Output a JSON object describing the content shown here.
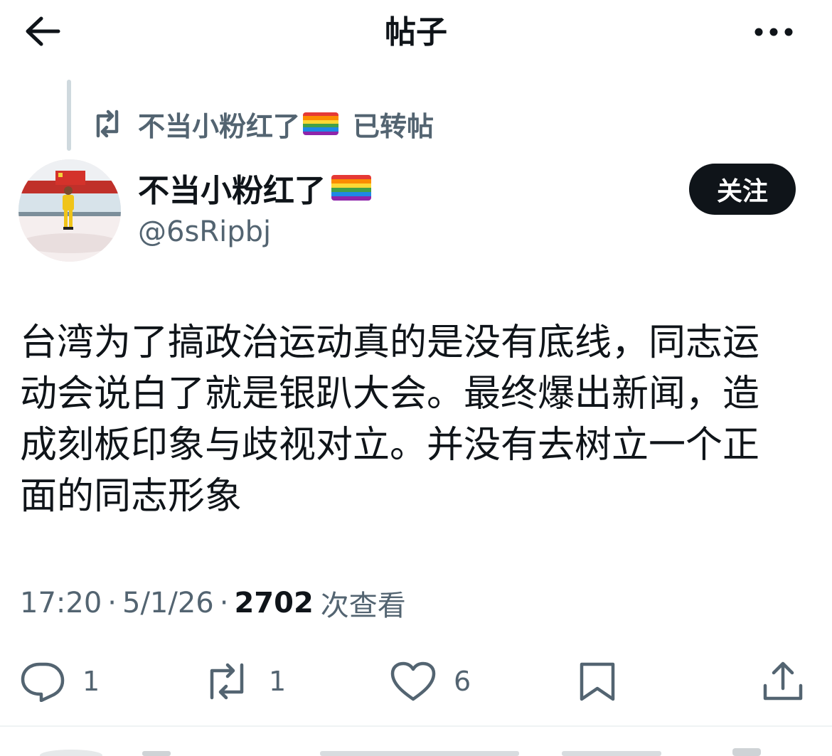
{
  "header": {
    "title": "帖子",
    "back_icon": "arrow-left-icon",
    "more_icon": "more-horizontal-icon"
  },
  "repost_context": {
    "icon": "repost-icon",
    "user": "不当小粉红了",
    "suffix": "已转帖"
  },
  "post": {
    "avatar_icon": "avatar-photo",
    "display_name": "不当小粉红了",
    "name_emoji": "rainbow-flag-icon",
    "handle": "@6sRipbj",
    "follow_label": "关注",
    "text": "台湾为了搞政治运动真的是没有底线，同志运动会说白了就是银趴大会。最终爆出新闻，造成刻板印象与歧视对立。并没有去树立一个正面的同志形象",
    "time": "17:20",
    "date": "5/1/26",
    "separator": "·",
    "views_count": "2702",
    "views_label": "次查看"
  },
  "actions": {
    "reply": {
      "icon": "reply-icon",
      "count": "1"
    },
    "repost": {
      "icon": "repost-icon",
      "count": "1"
    },
    "like": {
      "icon": "heart-icon",
      "count": "6"
    },
    "bookmark": {
      "icon": "bookmark-icon"
    },
    "share": {
      "icon": "share-icon"
    }
  },
  "colors": {
    "text_primary": "#0f1419",
    "text_secondary": "#536471",
    "follow_bg": "#0f1419",
    "divider": "#eff3f4"
  }
}
